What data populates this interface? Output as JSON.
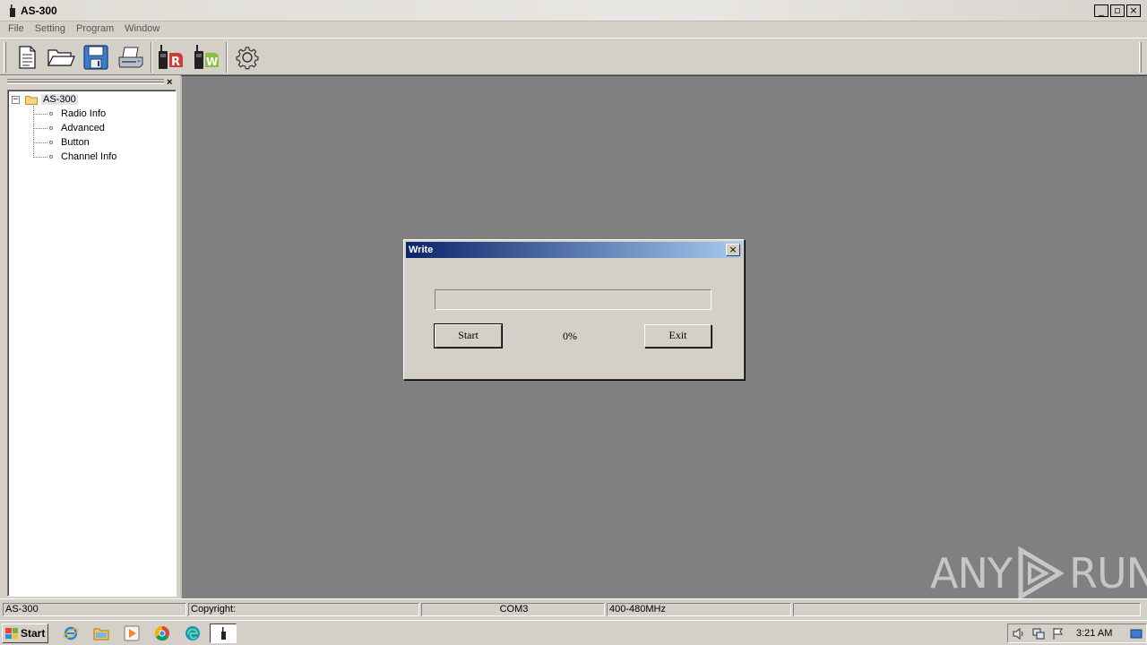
{
  "window": {
    "title": "AS-300",
    "minimize_glyph": "_",
    "restore_glyph": "▫",
    "close_glyph": "×"
  },
  "menu": [
    "File",
    "Setting",
    "Program",
    "Window"
  ],
  "toolbar": {
    "icons": [
      "new-document-icon",
      "open-folder-icon",
      "save-icon",
      "print-icon",
      "read-radio-icon",
      "write-radio-icon",
      "settings-gear-icon"
    ]
  },
  "side_panel": {
    "close_glyph": "×",
    "tree": {
      "root": "AS-300",
      "expander": "−",
      "items": [
        "Radio Info",
        "Advanced",
        "Button",
        "Channel Info"
      ]
    }
  },
  "dialog": {
    "title": "Write",
    "close_glyph": "×",
    "progress_percent": 0,
    "start_label": "Start",
    "percent_label": "0%",
    "exit_label": "Exit"
  },
  "statusbar": {
    "cells": [
      "AS-300",
      "Copyright:",
      "COM3",
      "400-480MHz",
      ""
    ]
  },
  "taskbar": {
    "start_label": "Start",
    "clock": "3:21 AM"
  },
  "watermark": {
    "left_text": "ANY",
    "right_text": "RUN"
  }
}
